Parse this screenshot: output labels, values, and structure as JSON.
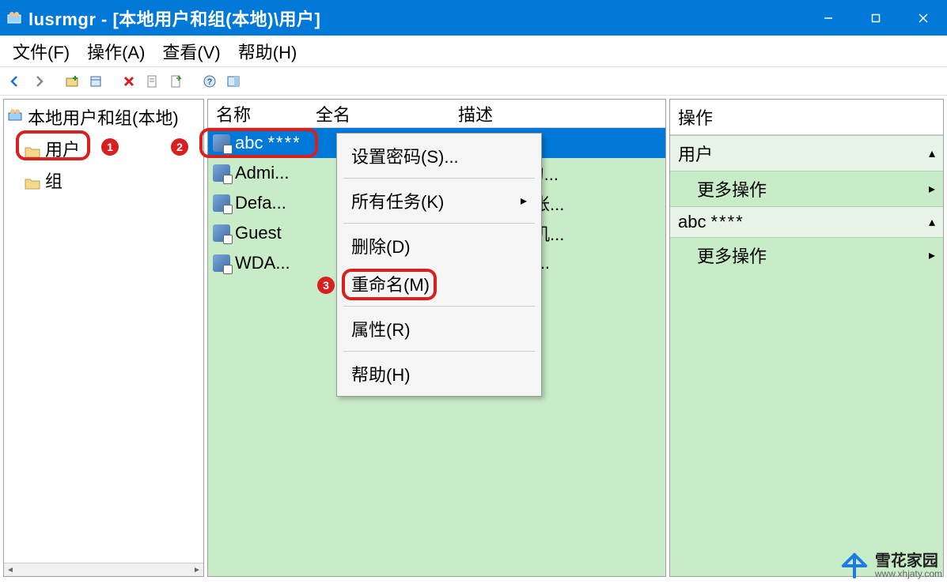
{
  "title": "lusrmgr - [本地用户和组(本地)\\用户]",
  "menu": {
    "file": "文件(F)",
    "action": "操作(A)",
    "view": "查看(V)",
    "help": "帮助(H)"
  },
  "tree": {
    "root": "本地用户和组(本地)",
    "users": "用户",
    "groups": "组"
  },
  "columns": {
    "name": "名称",
    "fullname": "全名",
    "desc": "描述"
  },
  "rows": [
    {
      "name": "abc",
      "name_suffix": "****",
      "desc": ""
    },
    {
      "name": "Admi...",
      "desc": "机(域)的..."
    },
    {
      "name": "Defa...",
      "desc": "的用户帐..."
    },
    {
      "name": "Guest",
      "desc": "问计算机..."
    },
    {
      "name": "WDA...",
      "desc": "ndows ..."
    }
  ],
  "context": {
    "set_pwd": "设置密码(S)...",
    "all_tasks": "所有任务(K)",
    "delete": "删除(D)",
    "rename": "重命名(M)",
    "props": "属性(R)",
    "help": "帮助(H)"
  },
  "actions": {
    "header": "操作",
    "section1": "用户",
    "more": "更多操作",
    "section2": "abc",
    "section2_suffix": "****"
  },
  "badges": {
    "b1": "1",
    "b2": "2",
    "b3": "3"
  },
  "watermark": {
    "name": "雪花家园",
    "url": "www.xhjaty.com"
  }
}
